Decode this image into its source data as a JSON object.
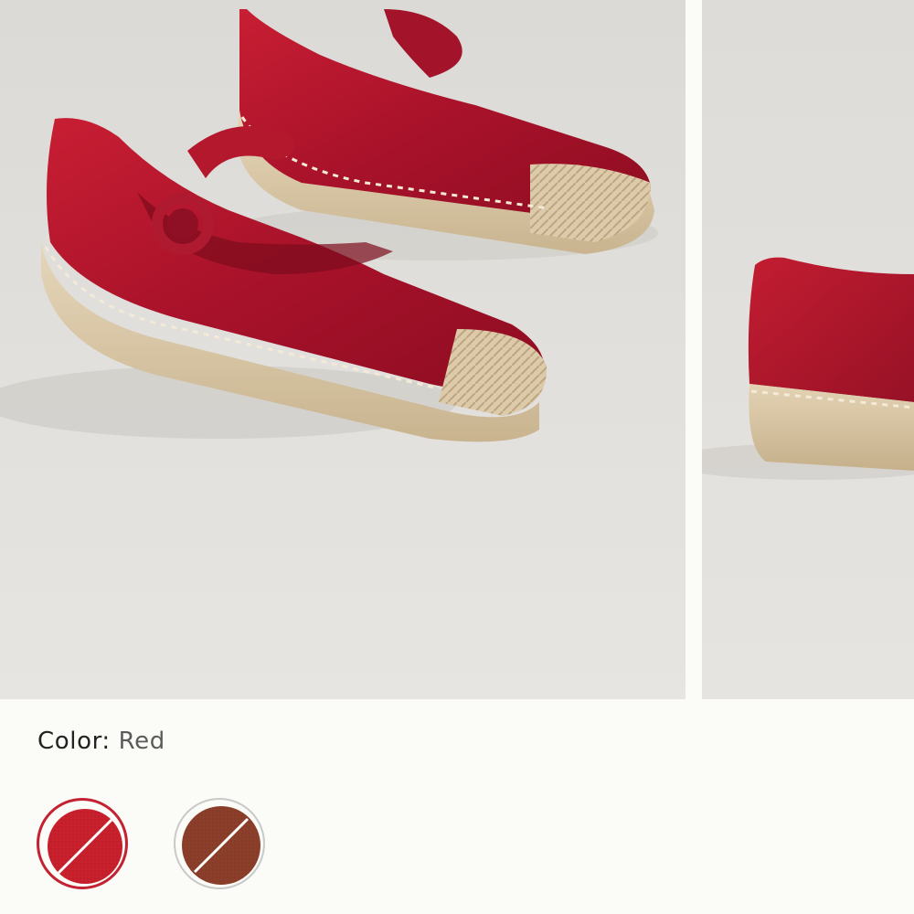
{
  "gallery": {
    "images": [
      {
        "icon": "red-mary-jane-espadrille-photo"
      },
      {
        "icon": "red-espadrille-side-photo"
      }
    ]
  },
  "color_selector": {
    "label": "Color:",
    "selected_value": "Red",
    "swatches": [
      {
        "color": "#c8202c",
        "selected": true,
        "icon": "red-swatch"
      },
      {
        "color": "#8b3f2b",
        "selected": false,
        "icon": "brown-swatch"
      }
    ],
    "selection_ring_color": "#c32232"
  },
  "colors": {
    "background": "#fbfbf8",
    "product_red": "#b8162a",
    "jute": "#d9c7a6"
  }
}
